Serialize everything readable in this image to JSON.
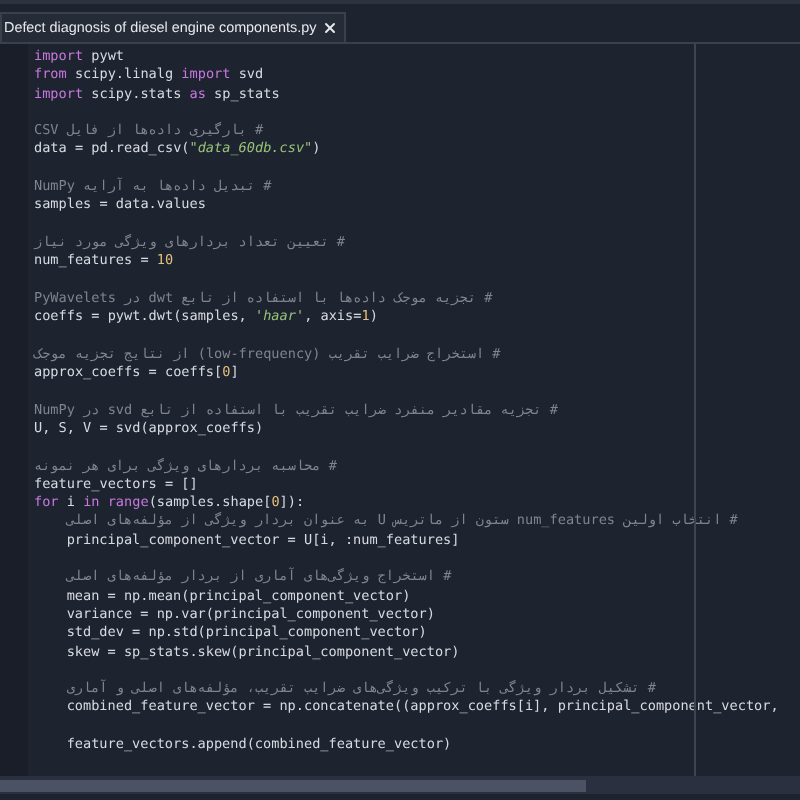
{
  "tab": {
    "title": "Defect diagnosis of diesel engine components.py"
  },
  "lines": [
    {
      "kind": "code",
      "tokens": [
        {
          "kind": "kw",
          "text": "import"
        },
        {
          "kind": "plain",
          "text": " pywt"
        }
      ]
    },
    {
      "kind": "code",
      "tokens": [
        {
          "kind": "kw",
          "text": "from"
        },
        {
          "kind": "plain",
          "text": " scipy.linalg "
        },
        {
          "kind": "kw",
          "text": "import"
        },
        {
          "kind": "plain",
          "text": " svd"
        }
      ]
    },
    {
      "kind": "code",
      "tokens": [
        {
          "kind": "kw",
          "text": "import"
        },
        {
          "kind": "plain",
          "text": " scipy.stats "
        },
        {
          "kind": "kw",
          "text": "as"
        },
        {
          "kind": "plain",
          "text": " sp_stats"
        }
      ]
    },
    {
      "kind": "blank"
    },
    {
      "kind": "comment",
      "text": "# بارگیری داده‌ها از فایل CSV"
    },
    {
      "kind": "code",
      "tokens": [
        {
          "kind": "plain",
          "text": "data = pd.read_csv("
        },
        {
          "kind": "str",
          "text": "\"data_60db.csv\""
        },
        {
          "kind": "plain",
          "text": ")"
        }
      ]
    },
    {
      "kind": "blank"
    },
    {
      "kind": "comment",
      "text": "# تبدیل داده‌ها به آرایه NumPy"
    },
    {
      "kind": "code",
      "tokens": [
        {
          "kind": "plain",
          "text": "samples = data.values"
        }
      ]
    },
    {
      "kind": "blank"
    },
    {
      "kind": "comment",
      "text": "# تعیین تعداد بردارهای ویژگی مورد نیاز"
    },
    {
      "kind": "code",
      "tokens": [
        {
          "kind": "plain",
          "text": "num_features = "
        },
        {
          "kind": "num",
          "text": "10"
        }
      ]
    },
    {
      "kind": "blank"
    },
    {
      "kind": "comment",
      "text": "# تجزیه موجک داده‌ها با استفاده از تابع dwt در PyWavelets"
    },
    {
      "kind": "code",
      "tokens": [
        {
          "kind": "plain",
          "text": "coeffs = pywt.dwt(samples, "
        },
        {
          "kind": "str",
          "text": "'haar'"
        },
        {
          "kind": "plain",
          "text": ", axis="
        },
        {
          "kind": "num",
          "text": "1"
        },
        {
          "kind": "plain",
          "text": ")"
        }
      ]
    },
    {
      "kind": "blank"
    },
    {
      "kind": "comment",
      "text": "# استخراج ضرایب تقریب (low-frequency) از نتایج تجزیه موجک"
    },
    {
      "kind": "code",
      "tokens": [
        {
          "kind": "plain",
          "text": "approx_coeffs = coeffs["
        },
        {
          "kind": "num",
          "text": "0"
        },
        {
          "kind": "plain",
          "text": "]"
        }
      ]
    },
    {
      "kind": "blank"
    },
    {
      "kind": "comment",
      "text": "# تجزیه مقادیر منفرد ضرایب تقریب با استفاده از تابع svd در NumPy"
    },
    {
      "kind": "code",
      "tokens": [
        {
          "kind": "plain",
          "text": "U, S, V = svd(approx_coeffs)"
        }
      ]
    },
    {
      "kind": "blank"
    },
    {
      "kind": "comment",
      "text": "# محاسبه بردارهای ویژگی برای هر نمونه"
    },
    {
      "kind": "code",
      "tokens": [
        {
          "kind": "plain",
          "text": "feature_vectors = []"
        }
      ]
    },
    {
      "kind": "code",
      "tokens": [
        {
          "kind": "kw",
          "text": "for"
        },
        {
          "kind": "plain",
          "text": " i "
        },
        {
          "kind": "kw",
          "text": "in range"
        },
        {
          "kind": "plain",
          "text": "(samples.shape["
        },
        {
          "kind": "num",
          "text": "0"
        },
        {
          "kind": "plain",
          "text": "]):"
        }
      ],
      "children": [
        {
          "kind": "comment",
          "text": "# انتخاب اولین num_features ستون از ماتریس U به عنوان بردار ویژگی از مؤلفه‌های اصلی"
        },
        {
          "kind": "code",
          "tokens": [
            {
              "kind": "plain",
              "text": "principal_component_vector = U[i, :num_features]"
            }
          ]
        },
        {
          "kind": "blank"
        },
        {
          "kind": "comment",
          "text": "# استخراج ویژگی‌های آماری از بردار مؤلفه‌های اصلی"
        },
        {
          "kind": "code",
          "tokens": [
            {
              "kind": "plain",
              "text": "mean = np.mean(principal_component_vector)"
            }
          ]
        },
        {
          "kind": "code",
          "tokens": [
            {
              "kind": "plain",
              "text": "variance = np.var(principal_component_vector)"
            }
          ]
        },
        {
          "kind": "code",
          "tokens": [
            {
              "kind": "plain",
              "text": "std_dev = np.std(principal_component_vector)"
            }
          ]
        },
        {
          "kind": "code",
          "tokens": [
            {
              "kind": "plain",
              "text": "skew = sp_stats.skew(principal_component_vector)"
            }
          ]
        },
        {
          "kind": "blank"
        },
        {
          "kind": "comment",
          "text": "# تشکیل بردار ویژگی با ترکیب ویژگی‌های ضرایب تقریب، مؤلفه‌های اصلی و آماری"
        },
        {
          "kind": "code",
          "tokens": [
            {
              "kind": "plain",
              "text": "combined_feature_vector = np.concatenate((approx_coeffs[i], principal_component_vector,"
            }
          ]
        },
        {
          "kind": "blank"
        },
        {
          "kind": "code",
          "tokens": [
            {
              "kind": "plain",
              "text": "feature_vectors.append(combined_feature_vector)"
            }
          ]
        }
      ]
    }
  ]
}
